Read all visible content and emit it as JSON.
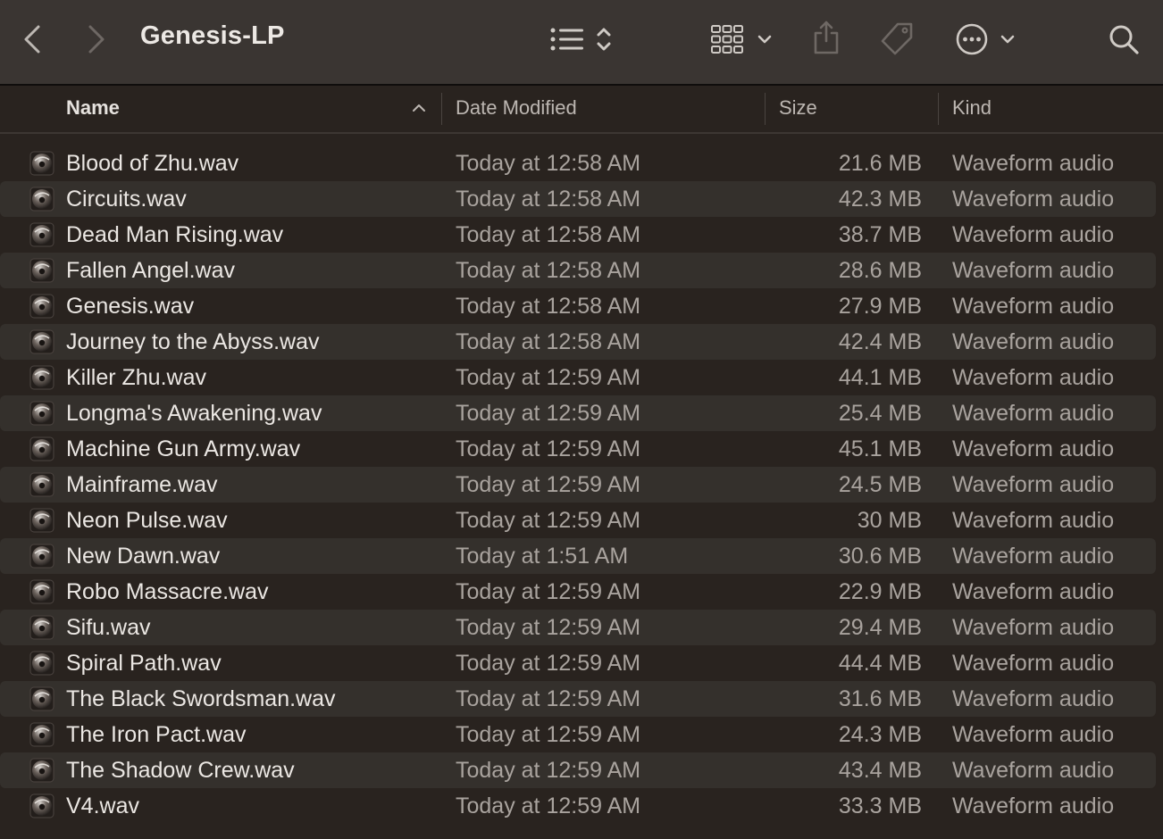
{
  "toolbar": {
    "title": "Genesis-LP",
    "icons": [
      "back-icon",
      "forward-icon",
      "list-view-icon",
      "sort-stepper-icon",
      "grid-view-icon",
      "chevron-down-icon",
      "share-icon",
      "tag-icon",
      "more-icon",
      "chevron-down-icon",
      "search-icon"
    ]
  },
  "columns": {
    "name": "Name",
    "date": "Date Modified",
    "size": "Size",
    "kind": "Kind"
  },
  "files": [
    {
      "name": "Blood of Zhu.wav",
      "date": "Today at 12:58 AM",
      "size": "21.6 MB",
      "kind": "Waveform audio"
    },
    {
      "name": "Circuits.wav",
      "date": "Today at 12:58 AM",
      "size": "42.3 MB",
      "kind": "Waveform audio"
    },
    {
      "name": "Dead Man Rising.wav",
      "date": "Today at 12:58 AM",
      "size": "38.7 MB",
      "kind": "Waveform audio"
    },
    {
      "name": "Fallen Angel.wav",
      "date": "Today at 12:58 AM",
      "size": "28.6 MB",
      "kind": "Waveform audio"
    },
    {
      "name": "Genesis.wav",
      "date": "Today at 12:58 AM",
      "size": "27.9 MB",
      "kind": "Waveform audio"
    },
    {
      "name": "Journey to the Abyss.wav",
      "date": "Today at 12:58 AM",
      "size": "42.4 MB",
      "kind": "Waveform audio"
    },
    {
      "name": "Killer Zhu.wav",
      "date": "Today at 12:59 AM",
      "size": "44.1 MB",
      "kind": "Waveform audio"
    },
    {
      "name": "Longma's Awakening.wav",
      "date": "Today at 12:59 AM",
      "size": "25.4 MB",
      "kind": "Waveform audio"
    },
    {
      "name": "Machine Gun Army.wav",
      "date": "Today at 12:59 AM",
      "size": "45.1 MB",
      "kind": "Waveform audio"
    },
    {
      "name": "Mainframe.wav",
      "date": "Today at 12:59 AM",
      "size": "24.5 MB",
      "kind": "Waveform audio"
    },
    {
      "name": "Neon Pulse.wav",
      "date": "Today at 12:59 AM",
      "size": "30 MB",
      "kind": "Waveform audio"
    },
    {
      "name": "New Dawn.wav",
      "date": "Today at 1:51 AM",
      "size": "30.6 MB",
      "kind": "Waveform audio"
    },
    {
      "name": "Robo Massacre.wav",
      "date": "Today at 12:59 AM",
      "size": "22.9 MB",
      "kind": "Waveform audio"
    },
    {
      "name": "Sifu.wav",
      "date": "Today at 12:59 AM",
      "size": "29.4 MB",
      "kind": "Waveform audio"
    },
    {
      "name": "Spiral Path.wav",
      "date": "Today at 12:59 AM",
      "size": "44.4 MB",
      "kind": "Waveform audio"
    },
    {
      "name": "The Black Swordsman.wav",
      "date": "Today at 12:59 AM",
      "size": "31.6 MB",
      "kind": "Waveform audio"
    },
    {
      "name": "The Iron Pact.wav",
      "date": "Today at 12:59 AM",
      "size": "24.3 MB",
      "kind": "Waveform audio"
    },
    {
      "name": "The Shadow Crew.wav",
      "date": "Today at 12:59 AM",
      "size": "43.4 MB",
      "kind": "Waveform audio"
    },
    {
      "name": "V4.wav",
      "date": "Today at 12:59 AM",
      "size": "33.3 MB",
      "kind": "Waveform audio"
    }
  ],
  "colors": {
    "toolbar_bg": "#3a3532",
    "list_bg": "#29231f",
    "alt_row_bg": "#34302c",
    "primary_text": "#ebe7e3",
    "secondary_text": "#a9a39e"
  }
}
